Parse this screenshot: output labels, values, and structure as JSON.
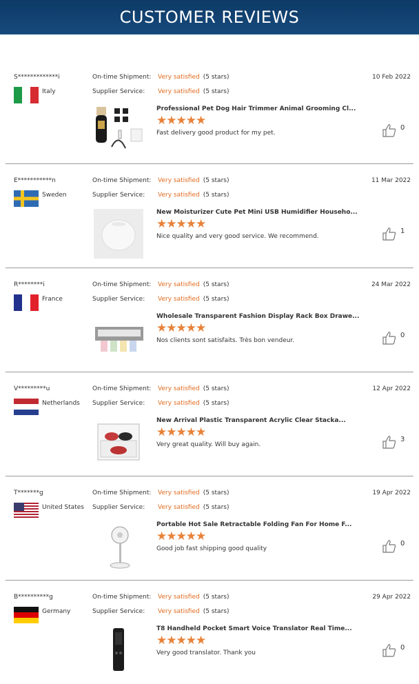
{
  "header": {
    "title": "CUSTOMER REVIEWS"
  },
  "labels": {
    "shipment": "On-time Shipment:",
    "service": "Supplier Service:"
  },
  "reviews": [
    {
      "user": "S*************i",
      "country": "Italy",
      "flag": "italy-flag-icon",
      "ship": "Very satisfied",
      "ship_stars": "(5 stars)",
      "svc": "Very satisfied",
      "svc_stars": "(5 stars)",
      "date": "10 Feb 2022",
      "product": "Professional Pet Dog Hair Trimmer Animal Grooming Cl...",
      "stars": "★★★★★",
      "comment": "Fast delivery good product for my pet.",
      "likes": "0",
      "thumb": "hair-trimmer-image"
    },
    {
      "user": "E***********n",
      "country": "Sweden",
      "flag": "sweden-flag-icon",
      "ship": "Very satisfied",
      "ship_stars": "(5 stars)",
      "svc": "Very satisfied",
      "svc_stars": "(5 stars)",
      "date": "11 Mar 2022",
      "product": "New Moisturizer Cute Pet Mini USB Humidifier Househo...",
      "stars": "★★★★★",
      "comment": "Nice quality and very good service. We recommend.",
      "likes": "1",
      "thumb": "humidifier-image"
    },
    {
      "user": "R********i",
      "country": "France",
      "flag": "france-flag-icon",
      "ship": "Very satisfied",
      "ship_stars": "(5 stars)",
      "svc": "Very satisfied",
      "svc_stars": "(5 stars)",
      "date": "24 Mar 2022",
      "product": "Wholesale Transparent Fashion Display Rack Box Drawe...",
      "stars": "★★★★★",
      "comment": "Nos clients sont satisfaits. Très bon vendeur.",
      "likes": "0",
      "thumb": "display-rack-image"
    },
    {
      "user": "V*********u",
      "country": "Netherlands",
      "flag": "netherlands-flag-icon",
      "ship": "Very satisfied",
      "ship_stars": "(5 stars)",
      "svc": "Very satisfied",
      "svc_stars": "(5 stars)",
      "date": "12 Apr 2022",
      "product": "New Arrival Plastic Transparent Acrylic Clear Stacka...",
      "stars": "★★★★★",
      "comment": "Very great quality. Will buy again.",
      "likes": "3",
      "thumb": "acrylic-box-image"
    },
    {
      "user": "T*******g",
      "country": "United States",
      "flag": "usa-flag-icon",
      "ship": "Very satisfied",
      "ship_stars": "(5 stars)",
      "svc": "Very satisfied",
      "svc_stars": "(5 stars)",
      "date": "19 Apr 2022",
      "product": "Portable Hot Sale Retractable Folding Fan For Home F...",
      "stars": "★★★★★",
      "comment": "Good job fast shipping good quality",
      "likes": "0",
      "thumb": "folding-fan-image"
    },
    {
      "user": "B**********g",
      "country": "Germany",
      "flag": "germany-flag-icon",
      "ship": "Very satisfied",
      "ship_stars": "(5 stars)",
      "svc": "Very satisfied",
      "svc_stars": "(5 stars)",
      "date": "29 Apr 2022",
      "product": "T8 Handheld Pocket Smart Voice Translator Real Time...",
      "stars": "★★★★★",
      "comment": "Very good translator. Thank you",
      "likes": "0",
      "thumb": "translator-image"
    }
  ],
  "colors": {
    "header_top": "#0d3a66",
    "header_bottom": "#174a7c",
    "satisfied": "#e06a1e",
    "stars": "#e8823a"
  }
}
